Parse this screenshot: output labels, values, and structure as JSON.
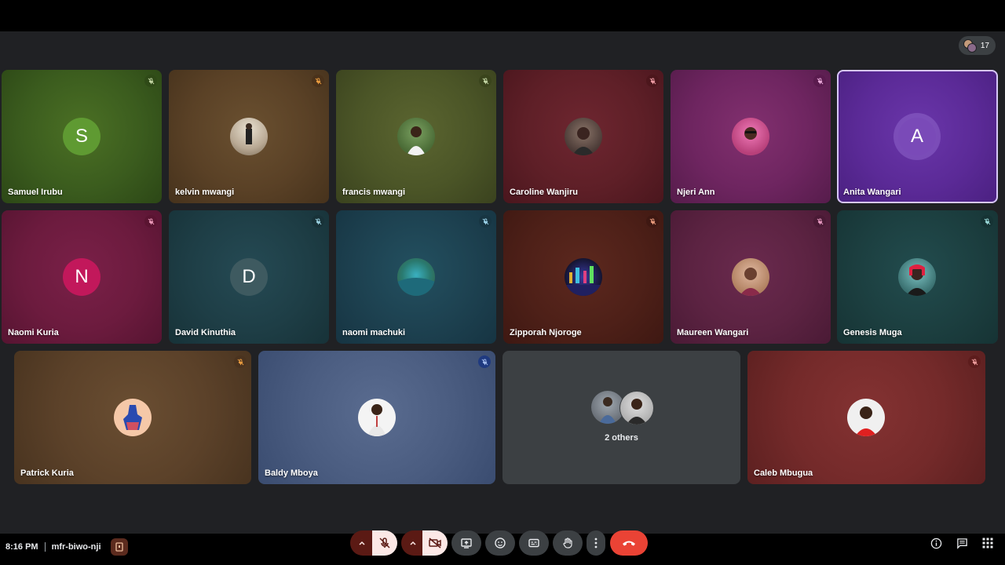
{
  "participant_count": "17",
  "tiles": [
    {
      "name": "Samuel Irubu",
      "initial": "S",
      "type": "initial",
      "bg": "#3b5c1e",
      "avatar_color": "#5f9a32",
      "mute_color": "#2f4a17"
    },
    {
      "name": "kelvin mwangi",
      "type": "photo",
      "bg": "#5a4126",
      "mute_color": "#4a321b"
    },
    {
      "name": "francis mwangi",
      "type": "photo",
      "bg": "#4b5527",
      "mute_color": "#3a441c"
    },
    {
      "name": "Caroline Wanjiru",
      "type": "photo",
      "bg": "#5e1f27",
      "mute_color": "#4c161c"
    },
    {
      "name": "Njeri Ann",
      "type": "photo",
      "bg": "#6e2560",
      "mute_color": "#5a1b4e"
    },
    {
      "name": "Anita Wangari",
      "initial": "A",
      "type": "initial",
      "bg": "#5b2a97",
      "avatar_color": "#7a4ab8",
      "mute_color": "#4a2080"
    },
    {
      "name": "Naomi Kuria",
      "initial": "N",
      "type": "initial",
      "bg": "#6c1b3e",
      "avatar_color": "#c2185b",
      "mute_color": "#5a1431"
    },
    {
      "name": "David Kinuthia",
      "initial": "D",
      "type": "initial",
      "bg": "#1e3e46",
      "avatar_color": "#3e5a60",
      "mute_color": "#183238"
    },
    {
      "name": "naomi machuki",
      "type": "photo",
      "bg": "#1d4150",
      "mute_color": "#173542"
    },
    {
      "name": "Zipporah Njoroge",
      "type": "photo",
      "bg": "#4e2018",
      "mute_color": "#3e1812"
    },
    {
      "name": "Maureen Wangari",
      "type": "photo",
      "bg": "#5c2342",
      "mute_color": "#4a1a35"
    },
    {
      "name": "Genesis Muga",
      "type": "photo",
      "bg": "#1c3f40",
      "mute_color": "#163334"
    },
    {
      "name": "Patrick Kuria",
      "type": "photo",
      "bg": "#5b4129",
      "mute_color": "#4a331f"
    },
    {
      "name": "Baldy Mboya",
      "type": "photo",
      "bg": "#4a5c80",
      "mute_color": "#1f3a80"
    },
    {
      "name": "",
      "type": "others",
      "bg": "#3c4043",
      "label": "2 others"
    },
    {
      "name": "Caleb Mbugua",
      "type": "photo",
      "bg": "#742a2a",
      "mute_color": "#5c1c1c"
    }
  ],
  "footer": {
    "time": "8:16 PM",
    "meeting_code": "mfr-biwo-nji"
  },
  "controls": {
    "mic": "mic-off",
    "camera": "camera-off",
    "present": "present",
    "reactions": "emoji",
    "captions": "captions",
    "raise_hand": "hand",
    "more": "more",
    "leave": "end-call"
  },
  "colors": {
    "accent_red": "#ea4335",
    "stage_bg": "#202124",
    "control_bg": "#3c4043"
  }
}
